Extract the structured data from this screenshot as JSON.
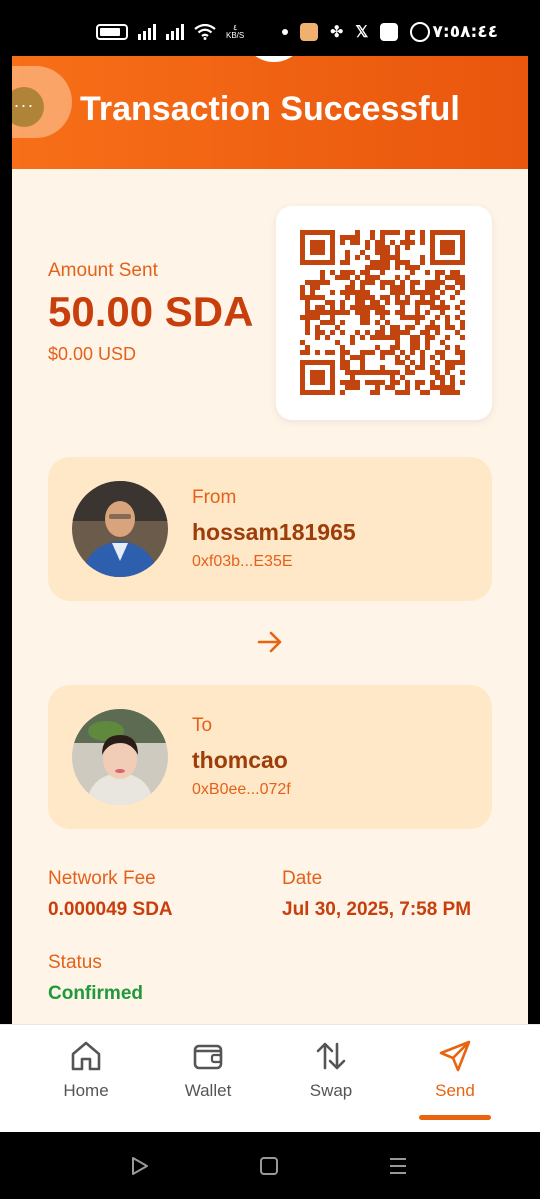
{
  "status_bar": {
    "kbs": "KB/S",
    "kbs_value": "٤",
    "time": "٧:٥٨:٤٤"
  },
  "header": {
    "title": "Transaction Successful",
    "menu_dots": "···"
  },
  "amount": {
    "label": "Amount Sent",
    "value": "50.00 SDA",
    "usd": "$0.00 USD"
  },
  "from": {
    "label": "From",
    "name": "hossam181965",
    "address": "0xf03b...E35E"
  },
  "to": {
    "label": "To",
    "name": "thomcao",
    "address": "0xB0ee...072f"
  },
  "details": {
    "fee_label": "Network Fee",
    "fee_value": "0.000049 SDA",
    "date_label": "Date",
    "date_value": "Jul 30, 2025, 7:58 PM",
    "status_label": "Status",
    "status_value": "Confirmed"
  },
  "nav": {
    "home": "Home",
    "wallet": "Wallet",
    "swap": "Swap",
    "send": "Send",
    "active": "send"
  },
  "colors": {
    "accent": "#e8640f",
    "header": "#f76f18",
    "background": "#fff4e8",
    "card": "#ffe8c8",
    "success": "#1f9a3a"
  }
}
